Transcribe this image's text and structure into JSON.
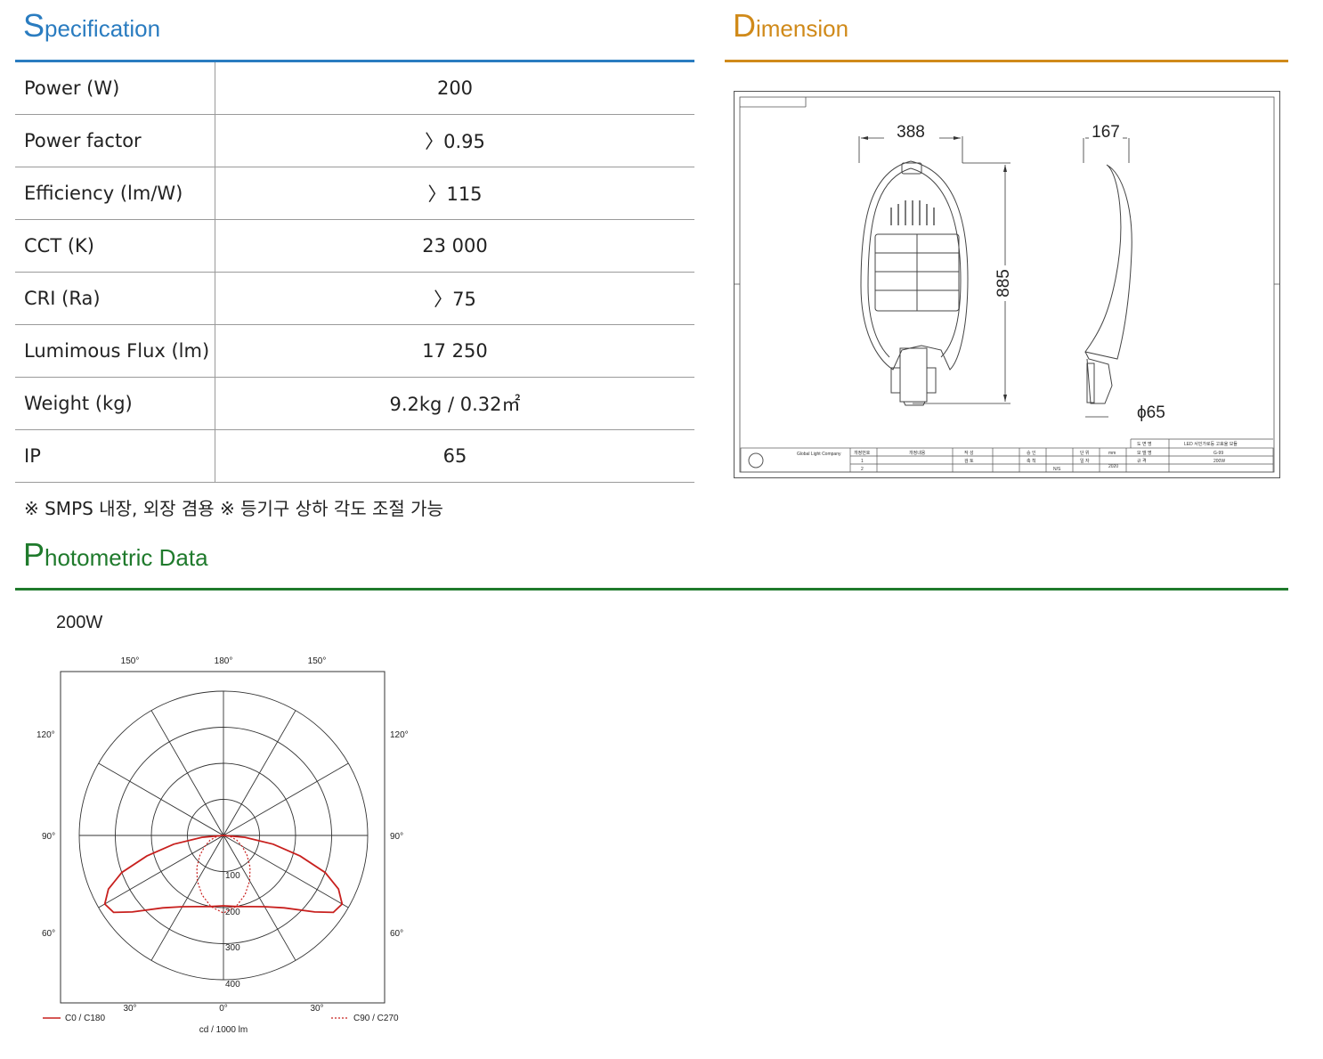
{
  "specification": {
    "title_cap": "S",
    "title_rest": "pecification",
    "rows": [
      {
        "label": "Power (W)",
        "value": "200"
      },
      {
        "label": "Power factor",
        "value": "〉0.95"
      },
      {
        "label": "Efficiency (lm/W)",
        "value": "〉115"
      },
      {
        "label": "CCT (K)",
        "value": "23 000"
      },
      {
        "label": "CRI (Ra)",
        "value": "〉75"
      },
      {
        "label": "Lumimous Flux (lm)",
        "value": "17 250"
      },
      {
        "label": "Weight (kg)",
        "value": "9.2kg / 0.32㎡"
      },
      {
        "label": "IP",
        "value": "65"
      }
    ],
    "note": "※ SMPS 내장, 외장 겸용 ※ 등기구 상하 각도 조절 가능",
    "color": "#2a7cc0"
  },
  "dimension": {
    "title_cap": "D",
    "title_rest": "imension",
    "color": "#d08a1a",
    "width_label": "388",
    "depth_label": "167",
    "height_label": "885",
    "pole_label": "ϕ65",
    "title_block": {
      "company": "Global Light Company",
      "drawing_name_label": "도 면 명",
      "drawing_name": "LED 서민가로등 고효율 모듈",
      "model_label": "모 델 명",
      "model": "G-99",
      "spec_label": "규 격",
      "spec": "200W",
      "unit_label": "단 위",
      "unit": "mm",
      "scale_label": "축 척",
      "scale": "N/S",
      "date_label": "일 자",
      "date": "2020",
      "rev_header": "개정번호",
      "rev_content": "개정내용",
      "rev_1": "1",
      "rev_2": "2",
      "drawn_label": "작 성",
      "checked_label": "검 토",
      "approved_label": "승 인"
    }
  },
  "photometric": {
    "title_cap": "P",
    "title_rest": "hotometric Data",
    "color": "#1f7a2c",
    "model_label": "200W",
    "axis_top": [
      "150°",
      "180°",
      "150°"
    ],
    "axis_side": [
      "120°",
      "90°",
      "60°"
    ],
    "axis_bottom": [
      "30°",
      "0°",
      "30°"
    ],
    "radial_ticks": [
      "100",
      "200",
      "300",
      "400"
    ],
    "unit_label": "cd / 1000 lm",
    "legend_c0": "C0 / C180",
    "legend_c90": "C90 / C270",
    "c0_color": "#c8201e",
    "c90_color": "#c8201e"
  },
  "chart_data": {
    "type": "polar",
    "radial_unit": "cd / 1000 lm",
    "rlim": [
      0,
      400
    ],
    "series": [
      {
        "name": "C0 / C180",
        "angles": [
          0,
          10,
          20,
          30,
          40,
          50,
          55,
          60,
          65,
          70,
          75,
          80,
          85,
          90
        ],
        "values": [
          195,
          200,
          210,
          228,
          262,
          330,
          372,
          380,
          352,
          300,
          220,
          140,
          60,
          0
        ]
      },
      {
        "name": "C90 / C270",
        "angles": [
          0,
          10,
          20,
          30,
          40,
          50,
          60,
          70,
          80,
          90
        ],
        "values": [
          215,
          200,
          175,
          145,
          115,
          85,
          60,
          40,
          20,
          0
        ]
      }
    ]
  }
}
